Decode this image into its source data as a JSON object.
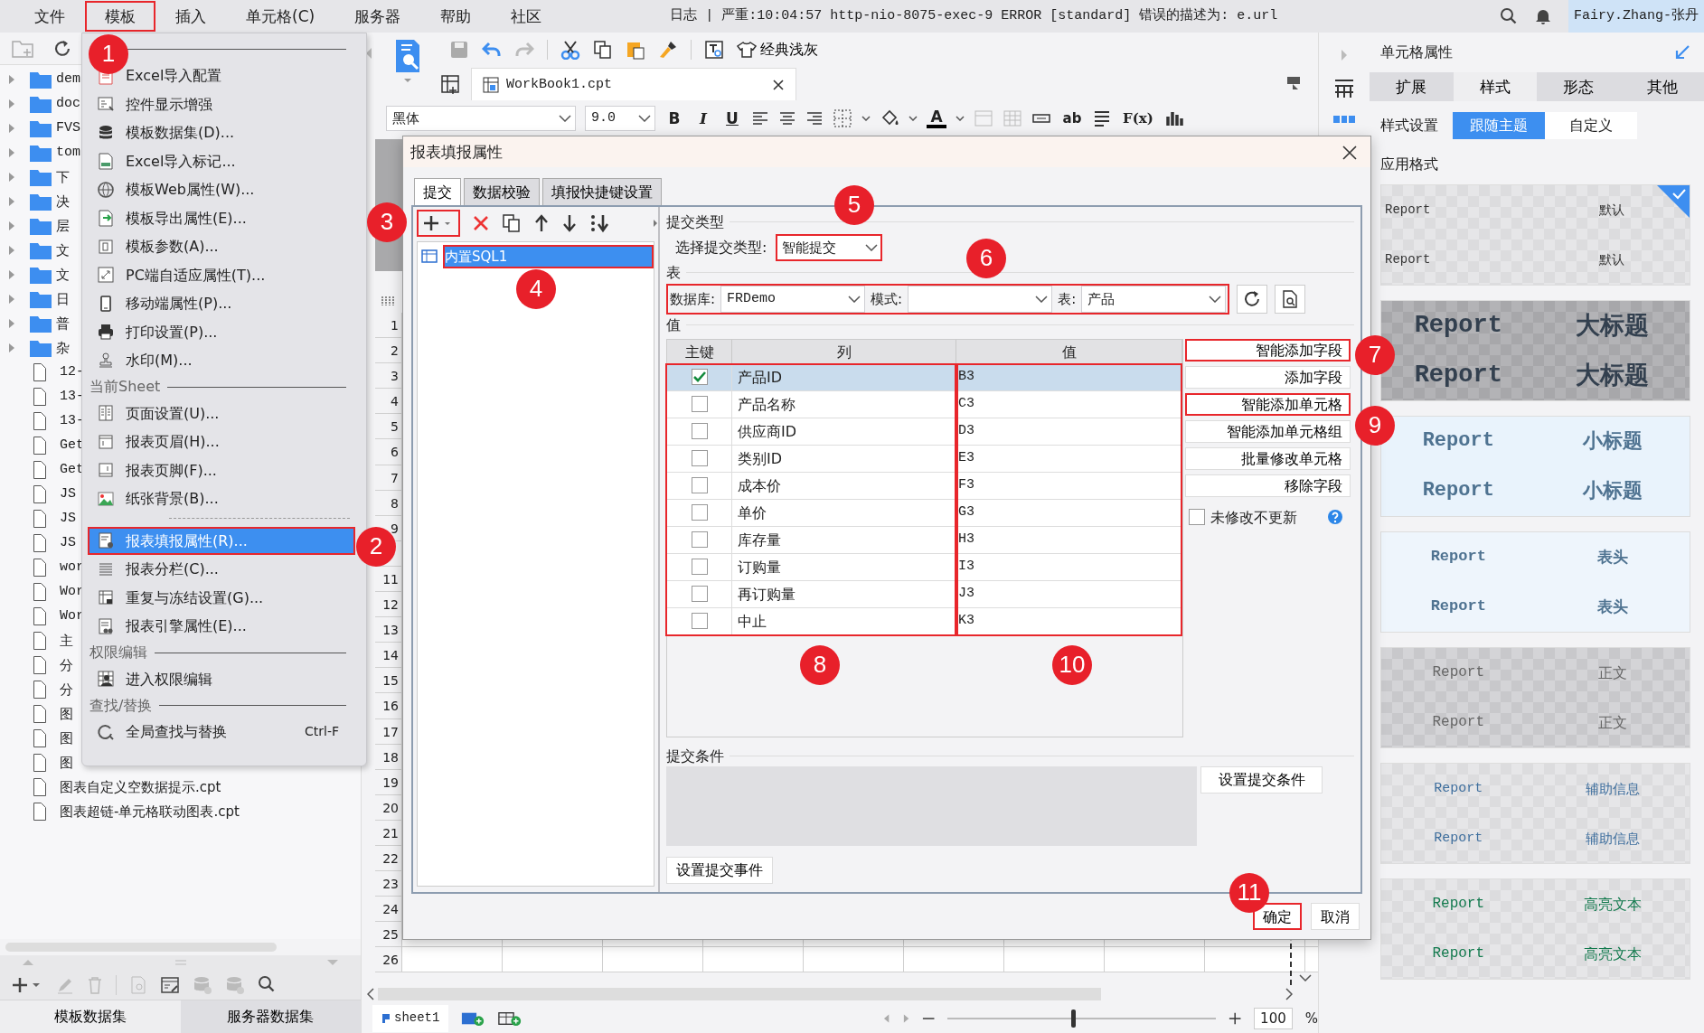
{
  "menubar": {
    "items": [
      {
        "label": "文件",
        "highlighted": false
      },
      {
        "label": "模板",
        "highlighted": true
      },
      {
        "label": "插入",
        "highlighted": false
      },
      {
        "label": "单元格(C)",
        "highlighted": false
      },
      {
        "label": "服务器",
        "highlighted": false
      },
      {
        "label": "帮助",
        "highlighted": false
      },
      {
        "label": "社区",
        "highlighted": false
      }
    ],
    "log": "日志 | 严重:10:04:57 http-nio-8075-exec-9 ERROR [standard] 错误的描述为: e.url",
    "user": "Fairy.Zhang-张丹"
  },
  "file_tree": {
    "items": [
      {
        "label": "dem",
        "kind": "folder"
      },
      {
        "label": "doc",
        "kind": "folder"
      },
      {
        "label": "FVS",
        "kind": "folder"
      },
      {
        "label": "tom",
        "kind": "folder"
      },
      {
        "label": "下",
        "kind": "folder"
      },
      {
        "label": "决",
        "kind": "folder"
      },
      {
        "label": "层",
        "kind": "folder"
      },
      {
        "label": "文",
        "kind": "folder"
      },
      {
        "label": "文",
        "kind": "folder"
      },
      {
        "label": "日",
        "kind": "folder"
      },
      {
        "label": "普",
        "kind": "folder"
      },
      {
        "label": "杂",
        "kind": "folder"
      },
      {
        "label": "12-",
        "kind": "file"
      },
      {
        "label": "13-",
        "kind": "file"
      },
      {
        "label": "13-",
        "kind": "file"
      },
      {
        "label": "Get",
        "kind": "file"
      },
      {
        "label": "Get",
        "kind": "file"
      },
      {
        "label": "JS",
        "kind": "file"
      },
      {
        "label": "JS",
        "kind": "file"
      },
      {
        "label": "JS",
        "kind": "file"
      },
      {
        "label": "wor",
        "kind": "file"
      },
      {
        "label": "Wor",
        "kind": "file"
      },
      {
        "label": "Wor",
        "kind": "file"
      },
      {
        "label": "主",
        "kind": "file"
      },
      {
        "label": "分",
        "kind": "file"
      },
      {
        "label": "分",
        "kind": "file"
      },
      {
        "label": "图",
        "kind": "file"
      },
      {
        "label": "图",
        "kind": "file"
      },
      {
        "label": "图",
        "kind": "file"
      },
      {
        "label": "图表自定义空数据提示.cpt",
        "kind": "file"
      },
      {
        "label": "图表超链-单元格联动图表.cpt",
        "kind": "file"
      }
    ]
  },
  "dataset_tabs": [
    {
      "label": "模板数据集",
      "selected": true
    },
    {
      "label": "服务器数据集",
      "selected": false
    }
  ],
  "dropdown": {
    "sections": [
      {
        "items": [
          {
            "kind": "item",
            "label": "Excel导入配置",
            "selected": false,
            "highlighted": false
          },
          {
            "kind": "item",
            "label": "控件显示增强",
            "selected": false,
            "highlighted": false
          },
          {
            "kind": "item",
            "label": "模板数据集(D)...",
            "selected": false,
            "highlighted": false
          },
          {
            "kind": "item",
            "label": "Excel导入标记...",
            "selected": false,
            "highlighted": false
          },
          {
            "kind": "item",
            "label": "模板Web属性(W)...",
            "selected": false,
            "highlighted": false
          },
          {
            "kind": "item",
            "label": "模板导出属性(E)...",
            "selected": false,
            "highlighted": false
          },
          {
            "kind": "item",
            "label": "模板参数(A)...",
            "selected": false,
            "highlighted": false
          },
          {
            "kind": "item",
            "label": "PC端自适应属性(T)...",
            "selected": false,
            "highlighted": false
          },
          {
            "kind": "item",
            "label": "移动端属性(P)...",
            "selected": false,
            "highlighted": false
          },
          {
            "kind": "item",
            "label": "打印设置(P)...",
            "selected": false,
            "highlighted": false
          },
          {
            "kind": "item",
            "label": "水印(M)...",
            "selected": false,
            "highlighted": false
          }
        ]
      },
      {
        "header": "当前Sheet",
        "items": [
          {
            "kind": "item",
            "label": "页面设置(U)...",
            "selected": false,
            "highlighted": false
          },
          {
            "kind": "item",
            "label": "报表页眉(H)...",
            "selected": false,
            "highlighted": false
          },
          {
            "kind": "item",
            "label": "报表页脚(F)...",
            "selected": false,
            "highlighted": false
          },
          {
            "kind": "item",
            "label": "纸张背景(B)...",
            "selected": false,
            "highlighted": false
          },
          {
            "kind": "separator"
          },
          {
            "kind": "item",
            "label": "报表填报属性(R)...",
            "selected": true,
            "highlighted": true
          },
          {
            "kind": "item",
            "label": "报表分栏(C)...",
            "selected": false,
            "highlighted": false
          },
          {
            "kind": "item",
            "label": "重复与冻结设置(G)...",
            "selected": false,
            "highlighted": false
          },
          {
            "kind": "item",
            "label": "报表引擎属性(E)...",
            "selected": false,
            "highlighted": false
          }
        ]
      },
      {
        "header": "权限编辑",
        "items": [
          {
            "kind": "item",
            "label": "进入权限编辑",
            "selected": false,
            "highlighted": false
          }
        ]
      },
      {
        "header": "查找/替换",
        "items": [
          {
            "kind": "item",
            "label": "全局查找与替换",
            "shortcut": "Ctrl-F",
            "selected": false,
            "highlighted": false
          }
        ]
      }
    ]
  },
  "editor": {
    "theme_button": "经典浅灰",
    "file_tab": "WorkBook1.cpt",
    "font": "黑体",
    "font_size": "9.0",
    "bold": "B",
    "italic": "I",
    "underline": "U",
    "font_color": "A",
    "text_button": "ab",
    "formula": "F(x)",
    "sheet_rows": [
      {
        "number": "1"
      },
      {
        "number": "2"
      },
      {
        "number": "3"
      },
      {
        "number": "4"
      },
      {
        "number": "5"
      },
      {
        "number": "6"
      },
      {
        "number": "7"
      },
      {
        "number": "8"
      },
      {
        "number": "9"
      },
      {},
      {
        "number": "11"
      },
      {
        "number": "12"
      },
      {
        "number": "13"
      },
      {
        "number": "14"
      },
      {
        "number": "15"
      },
      {
        "number": "16"
      },
      {
        "number": "17"
      },
      {
        "number": "18"
      },
      {
        "number": "19"
      },
      {
        "number": "20"
      },
      {
        "number": "21"
      },
      {
        "number": "22"
      },
      {
        "number": "23"
      },
      {
        "number": "24"
      },
      {
        "number": "25"
      },
      {
        "number": "26"
      }
    ],
    "sheet_tab": "sheet1",
    "zoom_slider": {
      "level": 0.46
    },
    "zoom": "100",
    "zoom_unit": "%"
  },
  "dialog": {
    "title": "报表填报属性",
    "tabs": [
      {
        "label": "提交",
        "selected": true
      },
      {
        "label": "数据校验",
        "selected": false
      },
      {
        "label": "填报快捷键设置",
        "selected": false
      }
    ],
    "add_button": {
      "highlighted": true
    },
    "sources": [
      {
        "label": "内置SQL1",
        "selected": true,
        "highlighted": true
      }
    ],
    "submit_type_heading": "提交类型",
    "submit_type_label": "选择提交类型:",
    "submit_type": {
      "value": "智能提交",
      "highlighted": true
    },
    "table_heading": "表",
    "table_row_highlighted": true,
    "database_label": "数据库:",
    "database": "FRDemo",
    "schema_label": "模式:",
    "table_label": "表:",
    "table": "产品",
    "values_heading": "值",
    "columns": [
      "主键",
      "列",
      "值"
    ],
    "fields": [
      {
        "primary_key": true,
        "column": "产品ID",
        "value": "B3",
        "selected": true
      },
      {
        "primary_key": false,
        "column": "产品名称",
        "value": "C3",
        "selected": false
      },
      {
        "primary_key": false,
        "column": "供应商ID",
        "value": "D3",
        "selected": false
      },
      {
        "primary_key": false,
        "column": "类别ID",
        "value": "E3",
        "selected": false
      },
      {
        "primary_key": false,
        "column": "成本价",
        "value": "F3",
        "selected": false
      },
      {
        "primary_key": false,
        "column": "单价",
        "value": "G3",
        "selected": false
      },
      {
        "primary_key": false,
        "column": "库存量",
        "value": "H3",
        "selected": false
      },
      {
        "primary_key": false,
        "column": "订购量",
        "value": "I3",
        "selected": false
      },
      {
        "primary_key": false,
        "column": "再订购量",
        "value": "J3",
        "selected": false
      },
      {
        "primary_key": false,
        "column": "中止",
        "value": "K3",
        "selected": false
      }
    ],
    "fields_outlined": true,
    "side_buttons": [
      {
        "label": "智能添加字段",
        "highlighted": true
      },
      {
        "label": "添加字段",
        "highlighted": false
      },
      {
        "label": "智能添加单元格",
        "highlighted": true
      },
      {
        "label": "智能添加单元格组",
        "highlighted": false
      },
      {
        "label": "批量修改单元格",
        "highlighted": false
      },
      {
        "label": "移除字段",
        "highlighted": false
      }
    ],
    "skip_unchanged": {
      "label": "未修改不更新",
      "checked": false
    },
    "condition_heading": "提交条件",
    "condition_button": "设置提交条件",
    "event_button": "设置提交事件",
    "ok": {
      "label": "确定",
      "highlighted": true
    },
    "cancel": "取消"
  },
  "cell_properties": {
    "title": "单元格属性",
    "tabs": [
      {
        "label": "扩展",
        "selected": false
      },
      {
        "label": "样式",
        "selected": true
      },
      {
        "label": "形态",
        "selected": false
      },
      {
        "label": "其他",
        "selected": false
      }
    ],
    "style_setting_label": "样式设置",
    "style_modes": [
      {
        "label": "跟随主题",
        "selected": true
      },
      {
        "label": "自定义",
        "selected": false
      }
    ],
    "apply_label": "应用格式",
    "style_cards": [
      {
        "kind": "default",
        "selected": true,
        "rows": [
          [
            "Report",
            "默认"
          ],
          [
            "Report",
            "默认"
          ]
        ]
      },
      {
        "kind": "title",
        "selected": false,
        "rows": [
          [
            "Report",
            "大标题"
          ],
          [
            "Report",
            "大标题"
          ]
        ]
      },
      {
        "kind": "subtitle",
        "selected": false,
        "rows": [
          [
            "Report",
            "小标题"
          ],
          [
            "Report",
            "小标题"
          ]
        ]
      },
      {
        "kind": "header",
        "selected": false,
        "rows": [
          [
            "Report",
            "表头"
          ],
          [
            "Report",
            "表头"
          ]
        ]
      },
      {
        "kind": "body",
        "selected": false,
        "rows": [
          [
            "Report",
            "正文"
          ],
          [
            "Report",
            "正文"
          ]
        ]
      },
      {
        "kind": "auxiliary",
        "selected": false,
        "rows": [
          [
            "Report",
            "辅助信息"
          ],
          [
            "Report",
            "辅助信息"
          ]
        ]
      },
      {
        "kind": "highlight",
        "selected": false,
        "rows": [
          [
            "Report",
            "高亮文本"
          ],
          [
            "Report",
            "高亮文本"
          ]
        ]
      }
    ]
  },
  "callouts": [
    "1",
    "2",
    "3",
    "4",
    "5",
    "6",
    "7",
    "8",
    "9",
    "10",
    "11"
  ]
}
